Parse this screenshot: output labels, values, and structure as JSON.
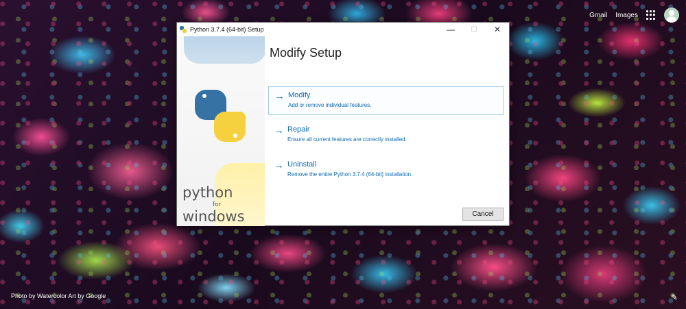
{
  "browser": {
    "links": [
      "Gmail",
      "Images"
    ],
    "credit": "Photo by Watercolor Art by Google"
  },
  "dialog": {
    "window_title": "Python 3.7.4 (64-bit) Setup",
    "controls": {
      "minimize": "—",
      "maximize": "☐",
      "close": "✕"
    },
    "heading": "Modify Setup",
    "side": {
      "line1": "python",
      "line2": "for",
      "line3": "windows"
    },
    "options": [
      {
        "title": "Modify",
        "description": "Add or remove individual features.",
        "arrow": "→"
      },
      {
        "title": "Repair",
        "description": "Ensure all current features are correctly installed.",
        "arrow": "→"
      },
      {
        "title": "Uninstall",
        "description": "Remove the entire Python 3.7.4 (64-bit) installation.",
        "arrow": "→"
      }
    ],
    "cancel_label": "Cancel"
  },
  "colors": {
    "accent": "#0a6ab8",
    "python_blue": "#3672a4",
    "python_yellow": "#f5d03f"
  }
}
